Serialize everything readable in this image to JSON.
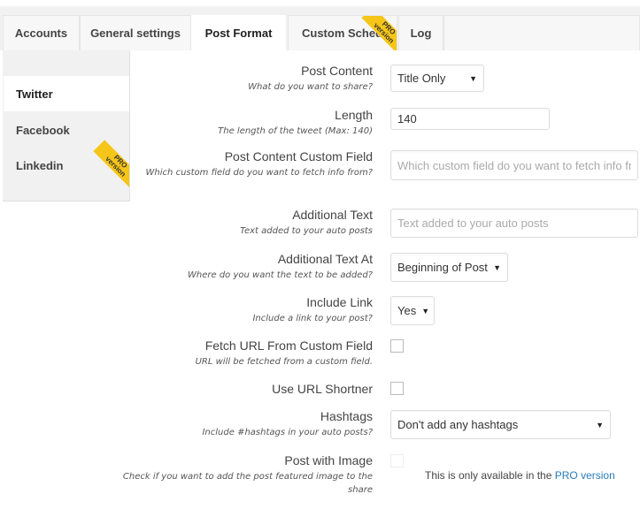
{
  "tabs": [
    {
      "label": "Accounts"
    },
    {
      "label": "General settings"
    },
    {
      "label": "Post Format",
      "active": true
    },
    {
      "label": "Custom Schedule",
      "badge": "PRO version"
    },
    {
      "label": "Log"
    }
  ],
  "sidebar": {
    "items": [
      {
        "label": "Twitter",
        "active": true
      },
      {
        "label": "Facebook"
      },
      {
        "label": "Linkedin",
        "badge": "PRO version"
      }
    ]
  },
  "badge": {
    "line1": "PRO",
    "line2": "version",
    "color": "#f5c518"
  },
  "fields": {
    "post_content": {
      "label": "Post Content",
      "desc": "What do you want to share?",
      "value": "Title Only"
    },
    "length": {
      "label": "Length",
      "desc": "The length of the tweet (Max: 140)",
      "value": "140"
    },
    "custom_field": {
      "label": "Post Content Custom Field",
      "desc": "Which custom field do you want to fetch info from?",
      "placeholder": "Which custom field do you want to fetch info from?"
    },
    "additional_text": {
      "label": "Additional Text",
      "desc": "Text added to your auto posts",
      "placeholder": "Text added to your auto posts"
    },
    "additional_text_at": {
      "label": "Additional Text At",
      "desc": "Where do you want the text to be added?",
      "value": "Beginning of Post"
    },
    "include_link": {
      "label": "Include Link",
      "desc": "Include a link to your post?",
      "value": "Yes"
    },
    "fetch_url": {
      "label": "Fetch URL From Custom Field",
      "desc": "URL will be fetched from a custom field.",
      "checked": false
    },
    "url_shortner": {
      "label": "Use URL Shortner",
      "checked": false
    },
    "hashtags": {
      "label": "Hashtags",
      "desc": "Include #hashtags in your auto posts?",
      "value": "Don't add any hashtags"
    },
    "post_with_image": {
      "label": "Post with Image",
      "desc": "Check if you want to add the post featured image to the share",
      "checked": false,
      "disabled": true,
      "note": "This is only available in the ",
      "note_link": "PRO version",
      "link_color": "#2b7bb9"
    }
  }
}
